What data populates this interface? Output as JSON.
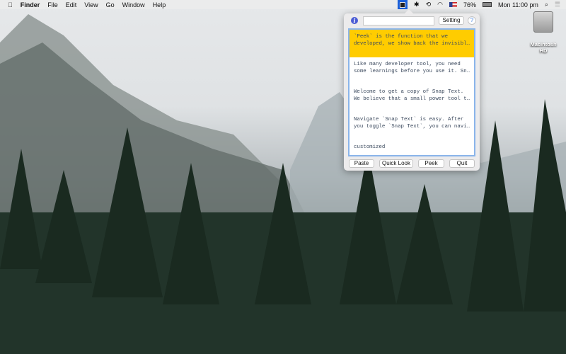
{
  "menubar": {
    "items": [
      "Finder",
      "File",
      "Edit",
      "View",
      "Go",
      "Window",
      "Help"
    ],
    "battery": "76%",
    "clock": "Mon 11:00 pm"
  },
  "popup": {
    "search_value": "",
    "setting_label": "Setting",
    "help_label": "?",
    "info_label": "i",
    "items": [
      {
        "lines": [
          "`Peek` is the function that we",
          "developed, we show back the invisibl…"
        ],
        "selected": true
      },
      {
        "lines": [
          "Like many developer tool, you need",
          "some learnings before you use it. Sn…"
        ]
      },
      {
        "lines": [
          "Welcome to get a copy of Snap Text.",
          "We believe that a small power tool t…"
        ]
      },
      {
        "lines": [
          "Navigate `Snap Text` is easy. After",
          "you toggle `Snap Text`, you can navi…"
        ]
      },
      {
        "lines": [
          "customized",
          ""
        ]
      }
    ],
    "buttons": {
      "paste": "Paste",
      "quicklook": "Quick Look",
      "peek": "Peek",
      "quit": "Quit"
    }
  },
  "desktop": {
    "disk_label": "Macintosh HD"
  }
}
